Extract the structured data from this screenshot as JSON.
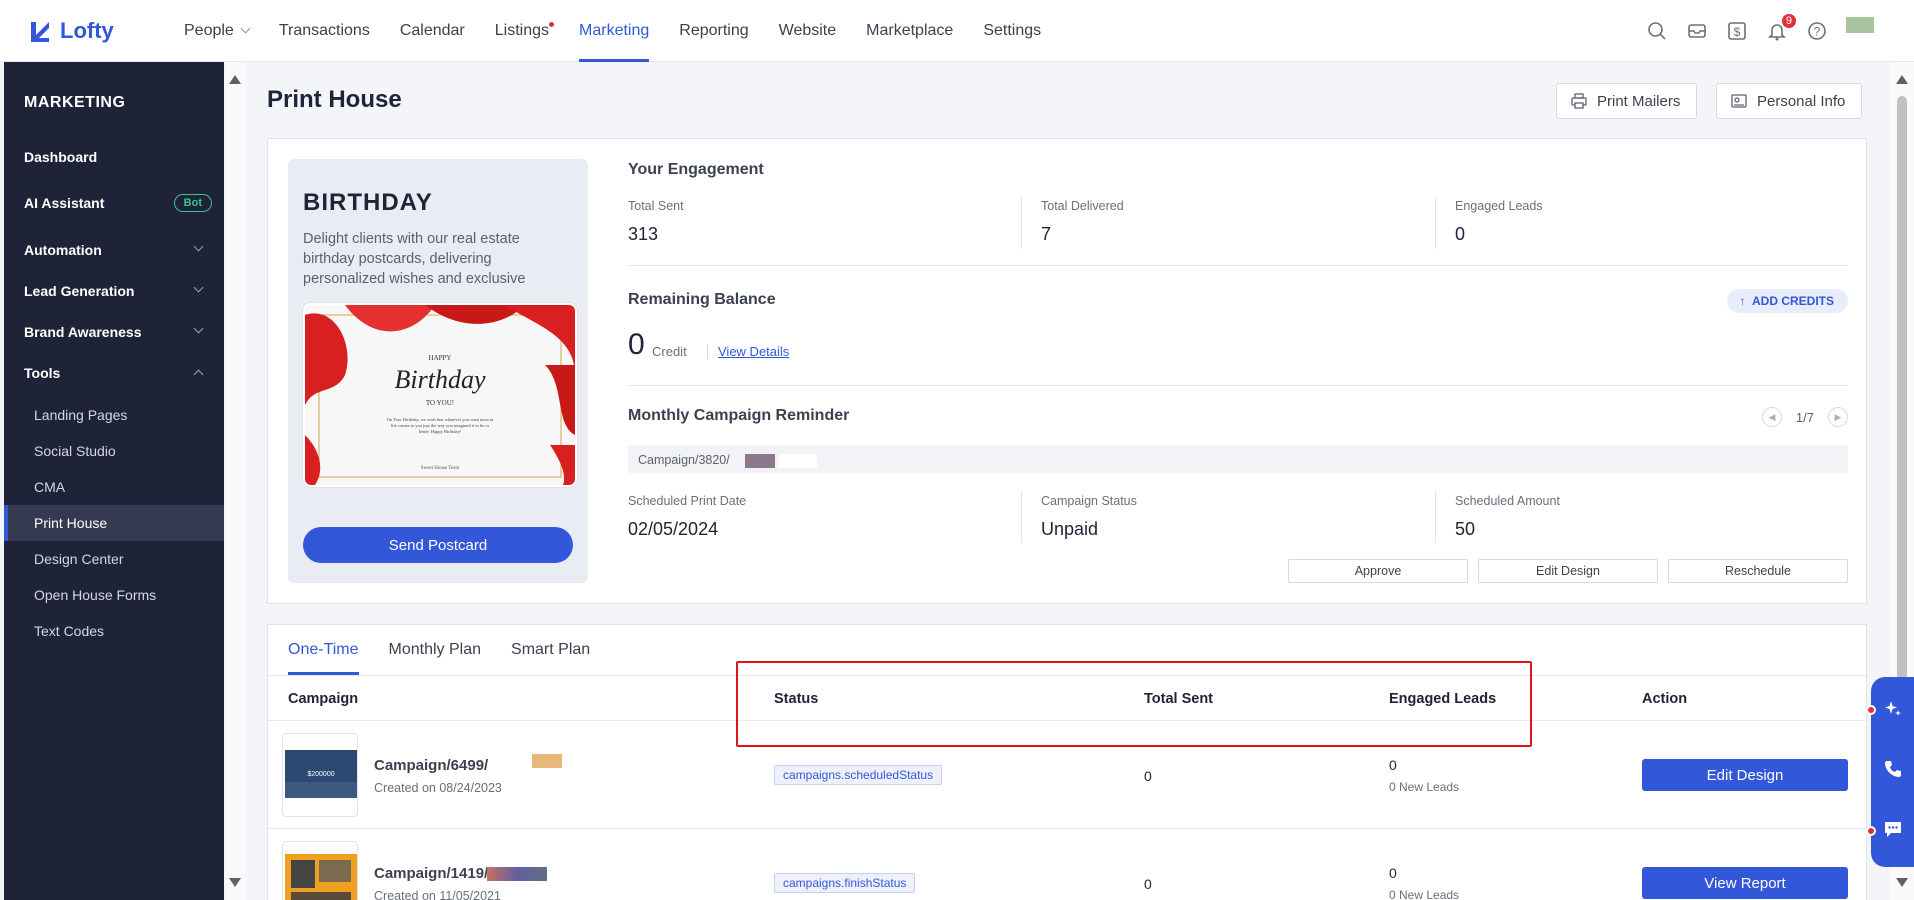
{
  "brand": {
    "name": "Lofty"
  },
  "nav": {
    "items": [
      "People",
      "Transactions",
      "Calendar",
      "Listings",
      "Marketing",
      "Reporting",
      "Website",
      "Marketplace",
      "Settings"
    ],
    "notification_count": "9"
  },
  "sidebar": {
    "title": "MARKETING",
    "items": [
      {
        "label": "Dashboard"
      },
      {
        "label": "AI Assistant",
        "badge": "Bot"
      },
      {
        "label": "Automation"
      },
      {
        "label": "Lead Generation"
      },
      {
        "label": "Brand Awareness"
      },
      {
        "label": "Tools"
      }
    ],
    "sub_items": [
      "Landing Pages",
      "Social Studio",
      "CMA",
      "Print House",
      "Design Center",
      "Open House Forms",
      "Text Codes"
    ]
  },
  "page": {
    "title": "Print House",
    "print_mailers": "Print Mailers",
    "personal_info": "Personal Info"
  },
  "promo": {
    "title": "BIRTHDAY",
    "description": "Delight clients with our real estate birthday postcards, delivering personalized wishes and exclusive",
    "postcard": {
      "happy": "HAPPY",
      "birthday": "Birthday",
      "to_you": "TO YOU!",
      "message": "On Your Birthday, we wish that whatever you want most in life comes to you just the way you imagined it to be or better. Happy Birthday!",
      "signature": "Sweet House Team"
    },
    "send_button": "Send Postcard"
  },
  "engagement": {
    "title": "Your Engagement",
    "total_sent_label": "Total Sent",
    "total_sent": "313",
    "total_delivered_label": "Total Delivered",
    "total_delivered": "7",
    "engaged_leads_label": "Engaged Leads",
    "engaged_leads": "0"
  },
  "balance": {
    "title": "Remaining Balance",
    "add_credits": "ADD CREDITS",
    "value": "0",
    "unit": "Credit",
    "view_details": "View Details"
  },
  "reminder": {
    "title": "Monthly Campaign Reminder",
    "pager": "1/7",
    "campaign": "Campaign/3820/",
    "print_date_label": "Scheduled Print Date",
    "print_date": "02/05/2024",
    "status_label": "Campaign Status",
    "status": "Unpaid",
    "amount_label": "Scheduled Amount",
    "amount": "50",
    "approve": "Approve",
    "edit_design": "Edit Design",
    "reschedule": "Reschedule"
  },
  "table": {
    "tabs": [
      "One-Time",
      "Monthly Plan",
      "Smart Plan"
    ],
    "headers": {
      "campaign": "Campaign",
      "status": "Status",
      "total_sent": "Total Sent",
      "engaged_leads": "Engaged Leads",
      "action": "Action"
    },
    "rows": [
      {
        "name": "Campaign/6499/",
        "date": "Created on 08/24/2023",
        "status": "campaigns.scheduledStatus",
        "total_sent": "0",
        "leads": "0",
        "new_leads": "0 New Leads",
        "action": "Edit Design",
        "thumb_text": "$200000"
      },
      {
        "name": "Campaign/1419/2",
        "date": "Created on 11/05/2021",
        "status": "campaigns.finishStatus",
        "total_sent": "0",
        "leads": "0",
        "new_leads": "0 New Leads",
        "action": "View Report"
      }
    ]
  },
  "colors": {
    "accent": "#3357d9",
    "sidebar": "#1f2338",
    "highlight": "#e0121b",
    "bot": "#37c58c"
  }
}
